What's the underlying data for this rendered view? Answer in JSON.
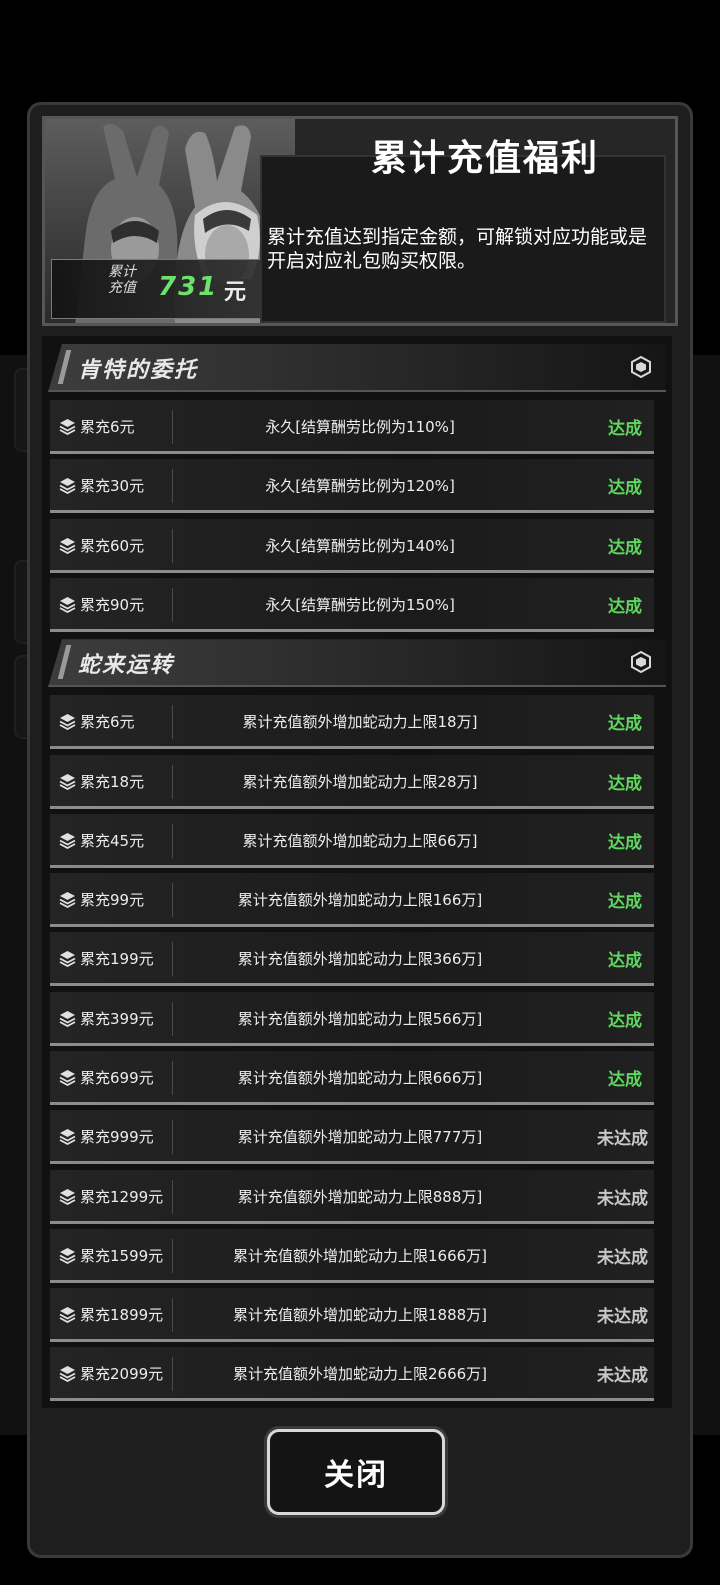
{
  "colors": {
    "achieved": "#5fd65f",
    "not_achieved": "#c8c8c8",
    "accumulated_value": "#6ee06e"
  },
  "header": {
    "title": "累计充值福利",
    "description": "累计充值达到指定金额，可解锁对应功能或是开启对应礼包购买权限。",
    "accumulated": {
      "label": "累计\n充值",
      "value": "731",
      "unit": "元"
    }
  },
  "sections": [
    {
      "title": "肯特的委托",
      "icon": "hexagon-icon",
      "rows": [
        {
          "requirement": "累充6元",
          "reward": "永久[结算酬劳比例为110%]",
          "status": "达成",
          "achieved": true
        },
        {
          "requirement": "累充30元",
          "reward": "永久[结算酬劳比例为120%]",
          "status": "达成",
          "achieved": true
        },
        {
          "requirement": "累充60元",
          "reward": "永久[结算酬劳比例为140%]",
          "status": "达成",
          "achieved": true
        },
        {
          "requirement": "累充90元",
          "reward": "永久[结算酬劳比例为150%]",
          "status": "达成",
          "achieved": true
        }
      ]
    },
    {
      "title": "蛇来运转",
      "icon": "hexagon-icon",
      "rows": [
        {
          "requirement": "累充6元",
          "reward": "累计充值额外增加蛇动力上限18万]",
          "status": "达成",
          "achieved": true
        },
        {
          "requirement": "累充18元",
          "reward": "累计充值额外增加蛇动力上限28万]",
          "status": "达成",
          "achieved": true
        },
        {
          "requirement": "累充45元",
          "reward": "累计充值额外增加蛇动力上限66万]",
          "status": "达成",
          "achieved": true
        },
        {
          "requirement": "累充99元",
          "reward": "累计充值额外增加蛇动力上限166万]",
          "status": "达成",
          "achieved": true
        },
        {
          "requirement": "累充199元",
          "reward": "累计充值额外增加蛇动力上限366万]",
          "status": "达成",
          "achieved": true
        },
        {
          "requirement": "累充399元",
          "reward": "累计充值额外增加蛇动力上限566万]",
          "status": "达成",
          "achieved": true
        },
        {
          "requirement": "累充699元",
          "reward": "累计充值额外增加蛇动力上限666万]",
          "status": "达成",
          "achieved": true
        },
        {
          "requirement": "累充999元",
          "reward": "累计充值额外增加蛇动力上限777万]",
          "status": "未达成",
          "achieved": false
        },
        {
          "requirement": "累充1299元",
          "reward": "累计充值额外增加蛇动力上限888万]",
          "status": "未达成",
          "achieved": false
        },
        {
          "requirement": "累充1599元",
          "reward": "累计充值额外增加蛇动力上限1666万]",
          "status": "未达成",
          "achieved": false
        },
        {
          "requirement": "累充1899元",
          "reward": "累计充值额外增加蛇动力上限1888万]",
          "status": "未达成",
          "achieved": false
        },
        {
          "requirement": "累充2099元",
          "reward": "累计充值额外增加蛇动力上限2666万]",
          "status": "未达成",
          "achieved": false
        }
      ]
    }
  ],
  "footer": {
    "close_label": "关闭"
  }
}
